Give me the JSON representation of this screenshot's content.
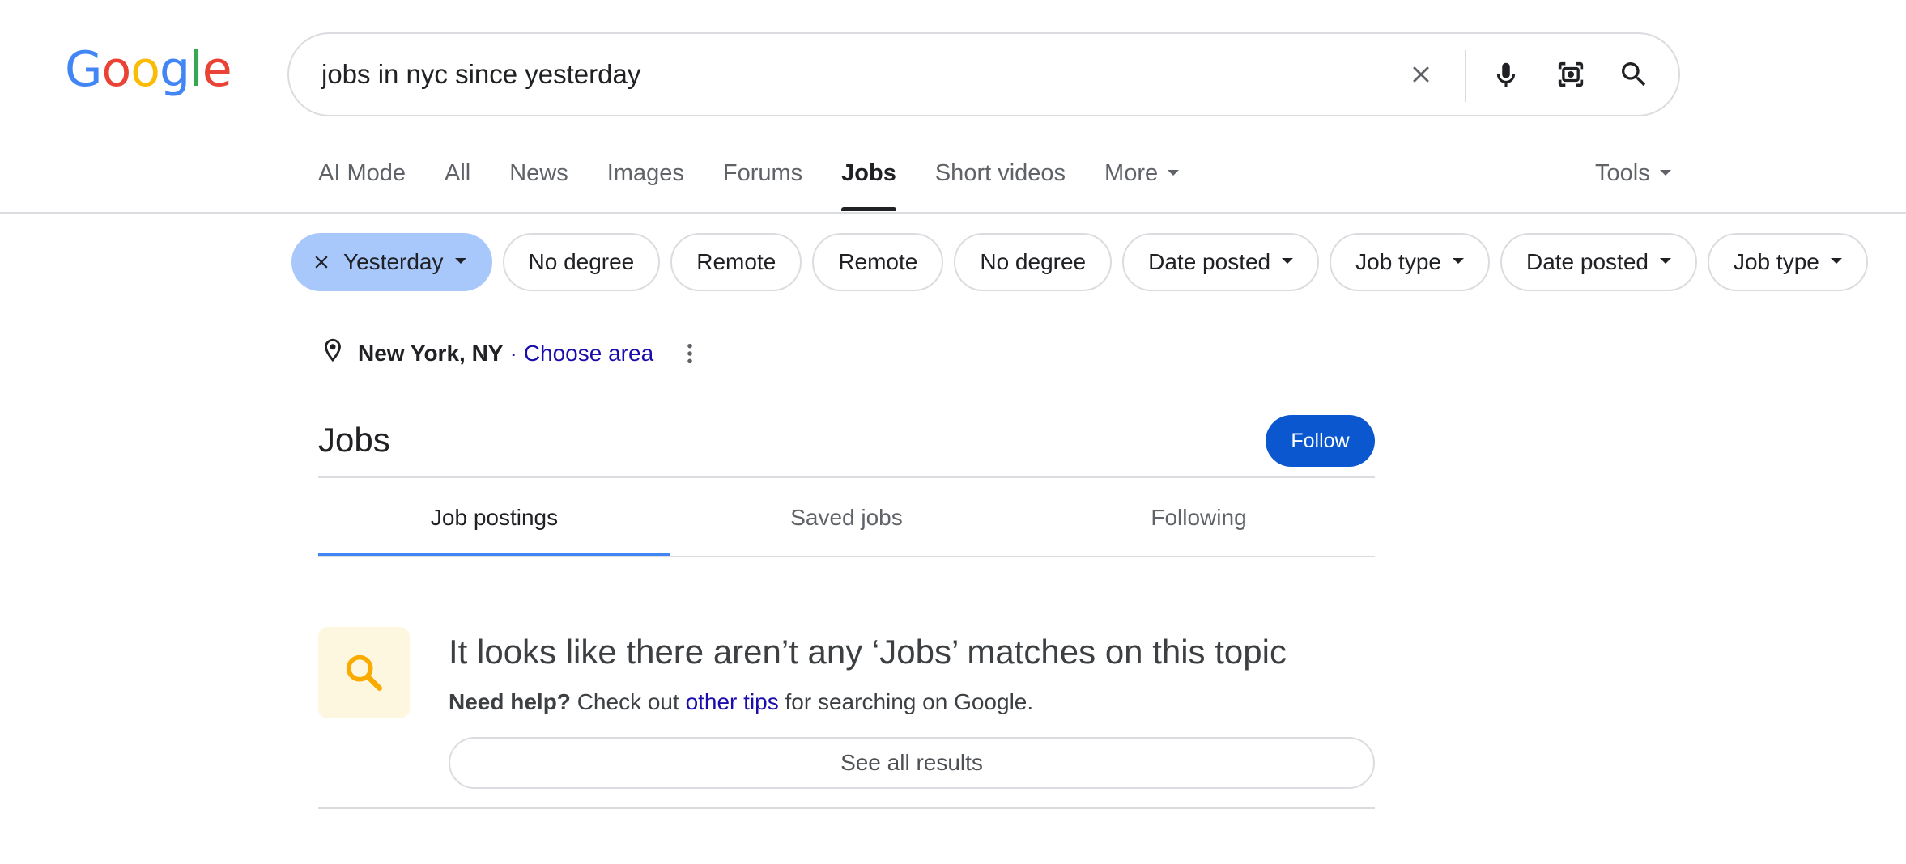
{
  "logo": {
    "text": "Google"
  },
  "search": {
    "query": "jobs in nyc since yesterday"
  },
  "tabs": [
    {
      "label": "AI Mode"
    },
    {
      "label": "All"
    },
    {
      "label": "News"
    },
    {
      "label": "Images"
    },
    {
      "label": "Forums"
    },
    {
      "label": "Jobs"
    },
    {
      "label": "Short videos"
    },
    {
      "label": "More"
    }
  ],
  "tools": {
    "label": "Tools"
  },
  "chips": [
    {
      "label": "Yesterday"
    },
    {
      "label": "No degree"
    },
    {
      "label": "Remote"
    },
    {
      "label": "Remote"
    },
    {
      "label": "No degree"
    },
    {
      "label": "Date posted"
    },
    {
      "label": "Job type"
    },
    {
      "label": "Date posted"
    },
    {
      "label": "Job type"
    }
  ],
  "location": {
    "city": "New York, NY",
    "separator": "·",
    "choose": "Choose area"
  },
  "jobs": {
    "title": "Jobs",
    "follow": "Follow"
  },
  "subtabs": [
    {
      "label": "Job postings"
    },
    {
      "label": "Saved jobs"
    },
    {
      "label": "Following"
    }
  ],
  "no_results": {
    "heading": "It looks like there aren’t any ‘Jobs’ matches on this topic",
    "help_bold": "Need help?",
    "help_pre": "Check out",
    "help_link": "other tips",
    "help_post": "for searching on Google.",
    "see_all": "See all results"
  },
  "colors": {
    "accent_blue": "#0b57d0",
    "chip_selected": "#a8c7fa",
    "link": "#1a0dab",
    "tab_indicator": "#4285F4",
    "icon_yellow": "#f9ab00"
  }
}
